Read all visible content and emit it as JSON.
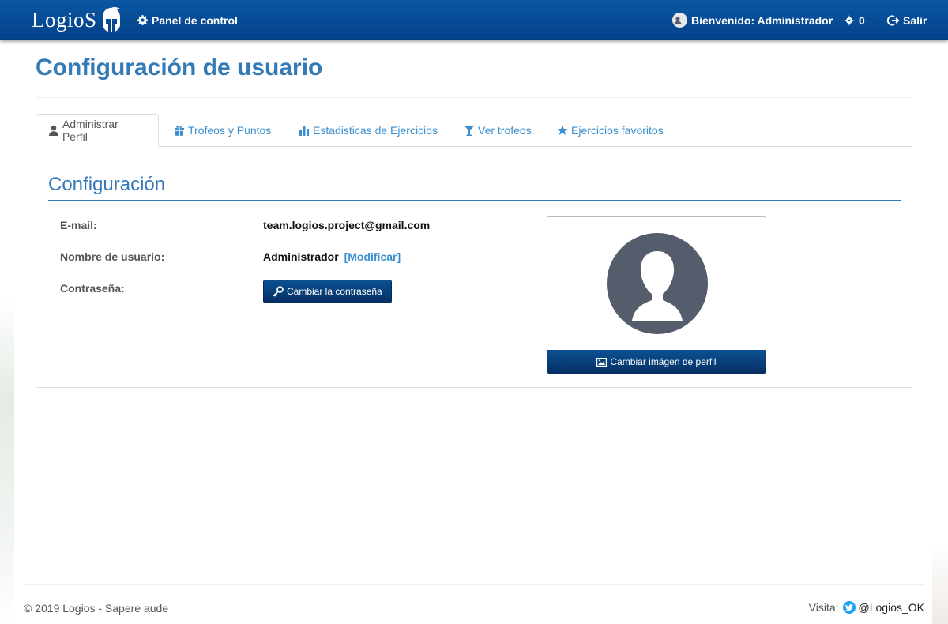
{
  "navbar": {
    "brand": "LogioS",
    "panel_label": "Panel de control",
    "welcome_label": "Bienvenido: Administrador",
    "points": "0",
    "exit_label": "Salir"
  },
  "page": {
    "title": "Configuración de usuario"
  },
  "tabs": [
    {
      "label": "Administrar Perfil",
      "icon": "user-icon",
      "active": true
    },
    {
      "label": "Trofeos y Puntos",
      "icon": "gift-icon",
      "active": false
    },
    {
      "label": "Estadisticas de Ejercicios",
      "icon": "bar-chart-icon",
      "active": false
    },
    {
      "label": "Ver trofeos",
      "icon": "trophy-cup-icon",
      "active": false
    },
    {
      "label": "Ejercicios favoritos",
      "icon": "star-icon",
      "active": false
    }
  ],
  "config": {
    "section_title": "Configuración",
    "email_label": "E-mail:",
    "email_value": "team.logios.project@gmail.com",
    "username_label": "Nombre de usuario:",
    "username_value": "Administrador",
    "modify_label": "[Modificar]",
    "password_label": "Contraseña:",
    "change_password_button": "Cambiar la contraseña",
    "change_image_button": "Cambiar imágen de perfil"
  },
  "footer": {
    "copyright": "© 2019 Logios - Sapere aude",
    "visit_label": "Visita:",
    "twitter_handle": "@Logios_OK"
  },
  "colors": {
    "navbar": "#04418a",
    "accent": "#337ab7",
    "link": "#3a8fd0",
    "button": "#052f62",
    "twitter": "#1da1f2"
  }
}
